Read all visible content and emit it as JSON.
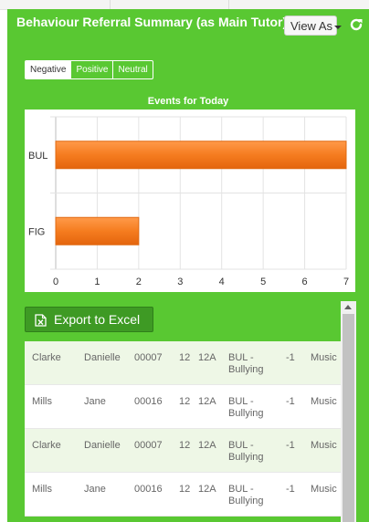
{
  "panel": {
    "title": "Behaviour Referral Summary (as Main Tutor)",
    "view_as_label": "View As",
    "refresh_icon": "refresh-icon",
    "accent_color": "#59c832"
  },
  "filters": [
    {
      "label": "Negative",
      "active": true
    },
    {
      "label": "Positive",
      "active": false
    },
    {
      "label": "Neutral",
      "active": false
    }
  ],
  "chart_data": {
    "type": "bar",
    "orientation": "horizontal",
    "title": "Events for Today",
    "categories": [
      "BUL",
      "FIG"
    ],
    "values": [
      7,
      2
    ],
    "xlim": [
      0,
      7
    ],
    "xticks": [
      "0",
      "1",
      "2",
      "3",
      "4",
      "5",
      "6",
      "7"
    ],
    "bar_color": "#f57c1f",
    "grid": true
  },
  "export": {
    "label": "Export to Excel",
    "icon": "excel-icon"
  },
  "table": {
    "rows": [
      [
        "Clarke",
        "Danielle",
        "00007",
        "12",
        "12A",
        "BUL - Bullying",
        "-1",
        "Music"
      ],
      [
        "Mills",
        "Jane",
        "00016",
        "12",
        "12A",
        "BUL - Bullying",
        "-1",
        "Music"
      ],
      [
        "Clarke",
        "Danielle",
        "00007",
        "12",
        "12A",
        "BUL - Bullying",
        "-1",
        "Music"
      ],
      [
        "Mills",
        "Jane",
        "00016",
        "12",
        "12A",
        "BUL - Bullying",
        "-1",
        "Music"
      ]
    ]
  }
}
